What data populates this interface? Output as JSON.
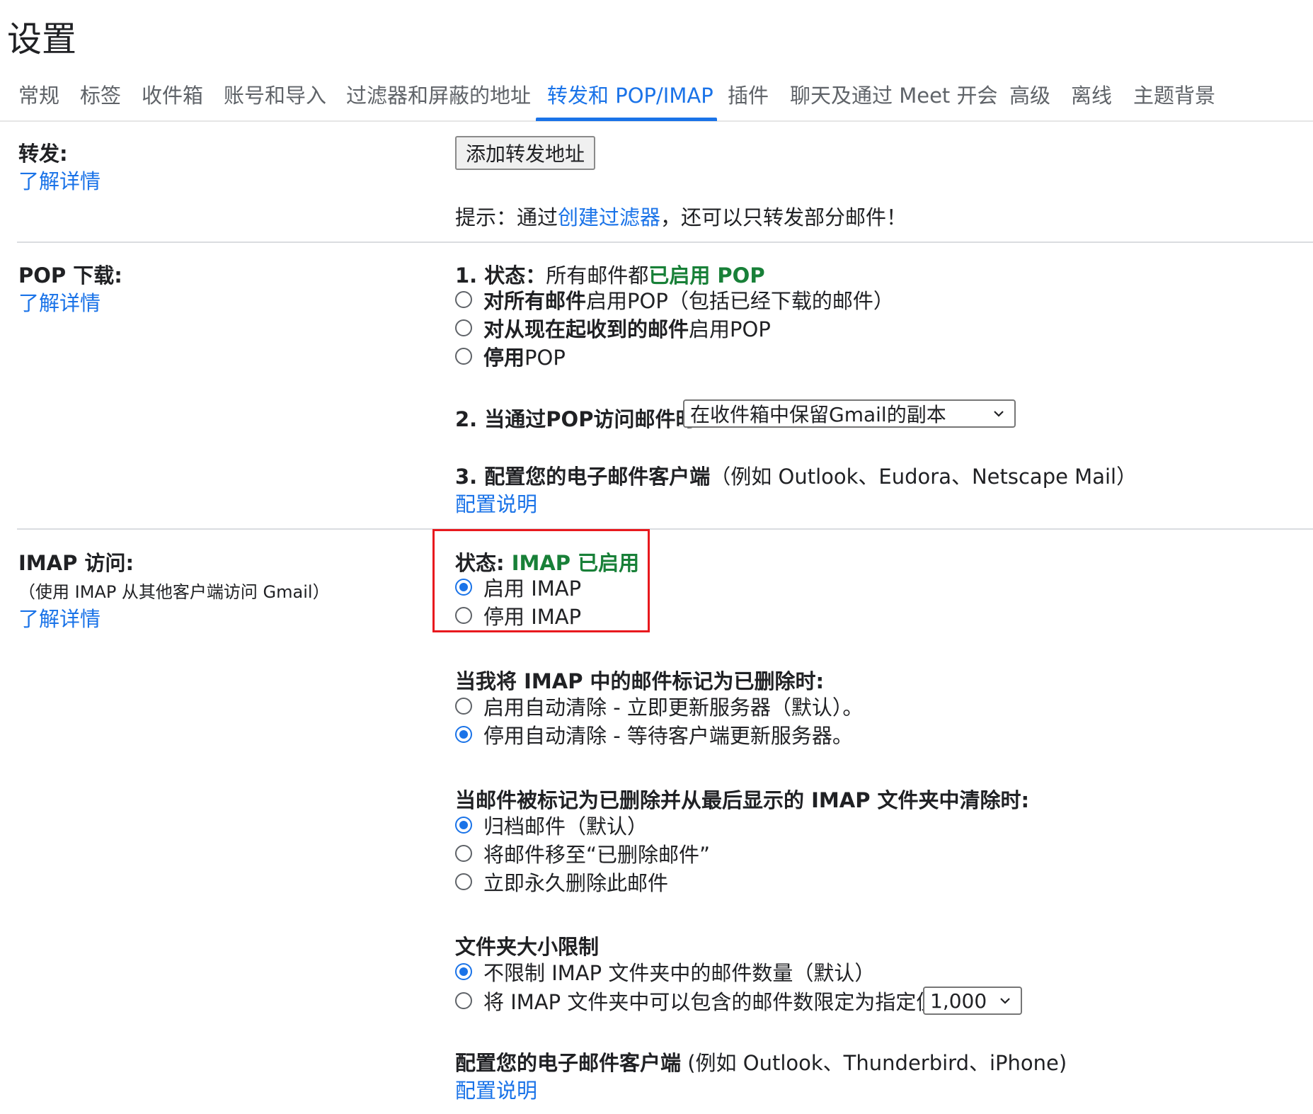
{
  "page_title": "设置",
  "tabs": [
    {
      "label": "常规"
    },
    {
      "label": "标签"
    },
    {
      "label": "收件箱"
    },
    {
      "label": "账号和导入"
    },
    {
      "label": "过滤器和屏蔽的地址"
    },
    {
      "label": "转发和 POP/IMAP"
    },
    {
      "label": "插件"
    },
    {
      "label": "聊天及通过 Meet 开会"
    },
    {
      "label": "高级"
    },
    {
      "label": "离线"
    },
    {
      "label": "主题背景"
    }
  ],
  "active_tab": "转发和 POP/IMAP",
  "learn_more": "了解详情",
  "forwarding": {
    "label": "转发:",
    "add_button": "添加转发地址",
    "tip_prefix": "提示：通过",
    "tip_link": "创建过滤器",
    "tip_suffix": "，还可以只转发部分邮件！"
  },
  "pop": {
    "label": "POP 下载:",
    "status_prefix": "1. 状态：",
    "status_text": "所有邮件都",
    "status_value": "已启用 POP",
    "options": [
      {
        "bold": "对所有邮件",
        "rest": "启用POP（包括已经下载的邮件）",
        "checked": false
      },
      {
        "bold": "对从现在起收到的邮件",
        "rest": "启用POP",
        "checked": false
      },
      {
        "bold": "停用",
        "rest": "POP",
        "checked": false
      }
    ],
    "access_label": "2. 当通过POP访问邮件时",
    "access_select_value": "在收件箱中保留Gmail的副本",
    "config_label": "3. 配置您的电子邮件客户端",
    "config_example": "（例如 Outlook、Eudora、Netscape Mail）",
    "config_link": "配置说明"
  },
  "imap": {
    "label": "IMAP 访问:",
    "sublabel": "（使用 IMAP 从其他客户端访问 Gmail）",
    "status_prefix": "状态: ",
    "status_value": "IMAP 已启用",
    "options": [
      {
        "label": "启用 IMAP",
        "checked": true
      },
      {
        "label": "停用 IMAP",
        "checked": false
      }
    ],
    "deleted_heading": "当我将 IMAP 中的邮件标记为已删除时:",
    "deleted_options": [
      {
        "label": "启用自动清除 - 立即更新服务器（默认）。",
        "checked": false
      },
      {
        "label": "停用自动清除 - 等待客户端更新服务器。",
        "checked": true
      }
    ],
    "expunge_heading": "当邮件被标记为已删除并从最后显示的 IMAP 文件夹中清除时:",
    "expunge_options": [
      {
        "label": "归档邮件（默认）",
        "checked": true
      },
      {
        "label": "将邮件移至“已删除邮件”",
        "checked": false
      },
      {
        "label": "立即永久删除此邮件",
        "checked": false
      }
    ],
    "folder_heading": "文件夹大小限制",
    "folder_options": [
      {
        "label": "不限制 IMAP 文件夹中的邮件数量（默认）",
        "checked": true
      },
      {
        "label": "将 IMAP 文件夹中可以包含的邮件数限定为指定值",
        "checked": false
      }
    ],
    "folder_limit_value": "1,000",
    "config_label": "配置您的电子邮件客户端",
    "config_example": " (例如 Outlook、Thunderbird、iPhone)",
    "config_link": "配置说明"
  }
}
